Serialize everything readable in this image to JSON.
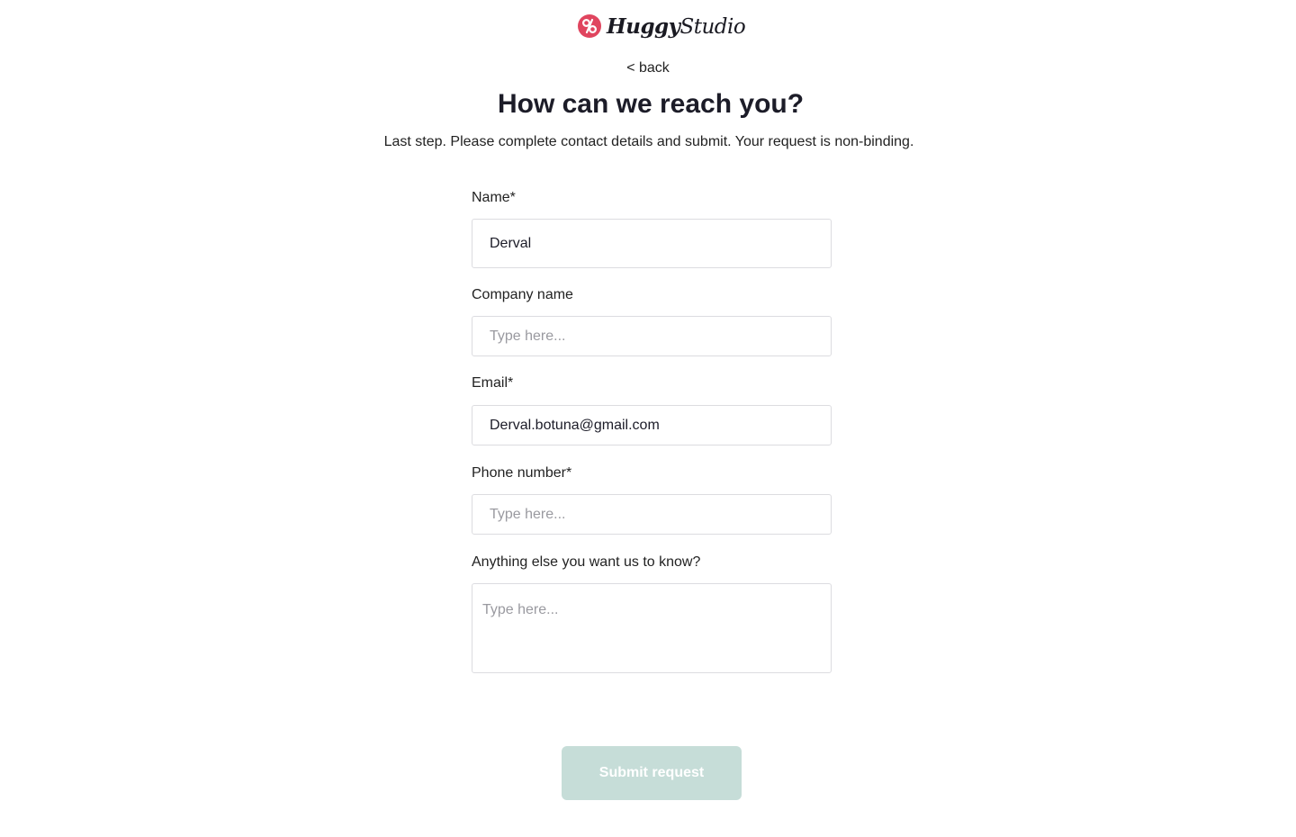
{
  "brand": {
    "logo_icon": "huggy-logo-icon",
    "name_bold": "Huggy",
    "name_regular": "Studio",
    "accent_color": "#e0455f"
  },
  "nav": {
    "back_label": "< back"
  },
  "header": {
    "title": "How can we reach you?",
    "subtitle": "Last step. Please complete contact details and submit. Your request is non-binding."
  },
  "form": {
    "name": {
      "label": "Name*",
      "value": "Derval",
      "placeholder": "Type here..."
    },
    "company": {
      "label": "Company name",
      "value": "",
      "placeholder": "Type here..."
    },
    "email": {
      "label": "Email*",
      "value": "Derval.botuna@gmail.com",
      "placeholder": "Type here..."
    },
    "phone": {
      "label": "Phone number*",
      "value": "",
      "placeholder": "Type here..."
    },
    "notes": {
      "label": "Anything else you want us to know?",
      "value": "",
      "placeholder": "Type here..."
    }
  },
  "actions": {
    "submit_label": "Submit request",
    "submit_color": "#c6ddd8"
  }
}
